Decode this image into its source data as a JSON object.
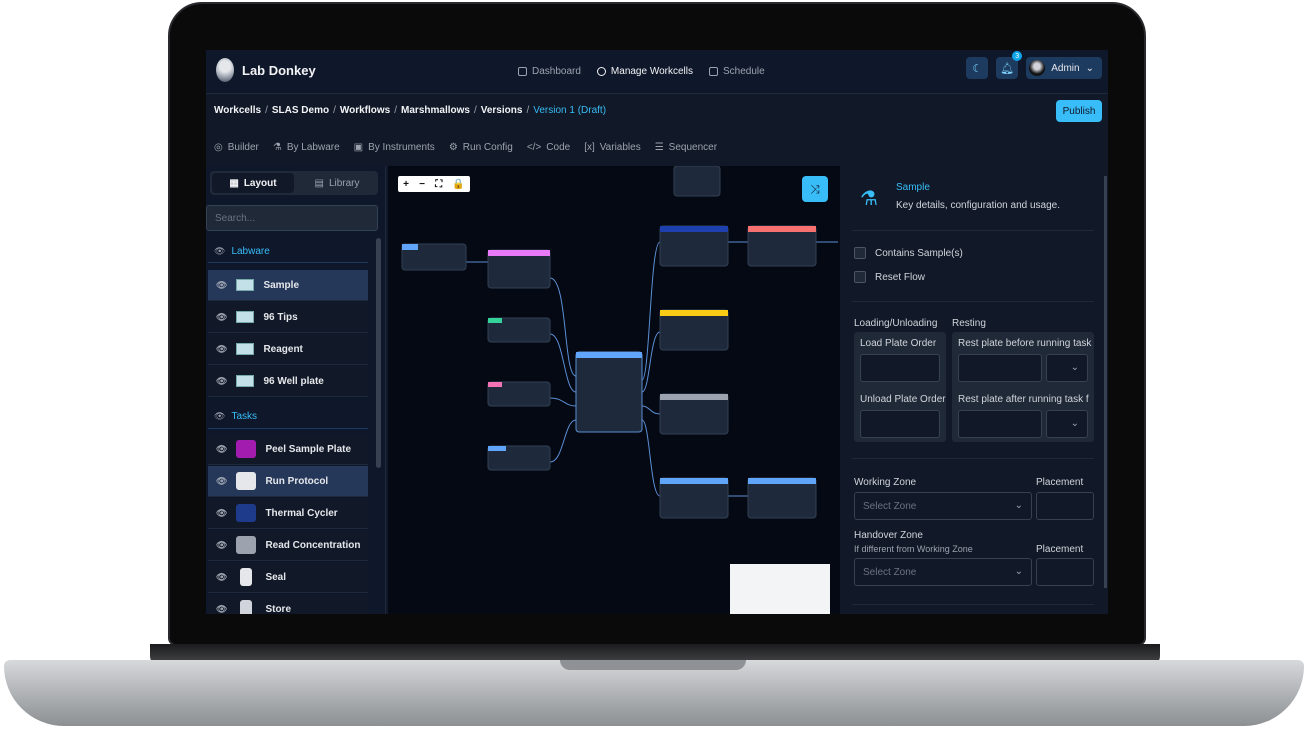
{
  "brand": {
    "name": "Lab Donkey"
  },
  "nav": {
    "items": [
      {
        "label": "Dashboard",
        "active": false
      },
      {
        "label": "Manage Workcells",
        "active": true
      },
      {
        "label": "Schedule",
        "active": false
      }
    ]
  },
  "header": {
    "notification_count": "3",
    "user": "Admin"
  },
  "breadcrumbs": {
    "items": [
      "Workcells",
      "SLAS Demo",
      "Workflows",
      "Marshmallows",
      "Versions"
    ],
    "current": "Version 1 (Draft)"
  },
  "actions": {
    "publish": "Publish"
  },
  "toolbar": {
    "items": [
      "Builder",
      "By Labware",
      "By Instruments",
      "Run Config",
      "Code",
      "Variables",
      "Sequencer"
    ]
  },
  "sidebar": {
    "tabs": [
      "Layout",
      "Library"
    ],
    "search_placeholder": "Search...",
    "labware_heading": "Labware",
    "labware": [
      "Sample",
      "96 Tips",
      "Reagent",
      "96 Well plate"
    ],
    "tasks_heading": "Tasks",
    "tasks": [
      {
        "label": "Peel Sample Plate",
        "color": "#a21caf"
      },
      {
        "label": "Run Protocol",
        "color": "#e5e7eb"
      },
      {
        "label": "Thermal Cycler",
        "color": "#1e3a8a"
      },
      {
        "label": "Read Concentration",
        "color": "#9ca3af"
      },
      {
        "label": "Seal",
        "color": "#e5e7eb"
      },
      {
        "label": "Store",
        "color": "#d1d5db"
      }
    ]
  },
  "canvas": {
    "zoom_controls": [
      "+",
      "−",
      "⛶",
      "🔒"
    ]
  },
  "props": {
    "title": "Sample",
    "subtitle": "Key details, configuration and usage.",
    "checks": [
      "Contains Sample(s)",
      "Reset Flow"
    ],
    "loading_heading": "Loading/Unloading",
    "resting_heading": "Resting",
    "load_plate_order": "Load Plate Order",
    "unload_plate_order": "Unload Plate Order",
    "rest_before": "Rest plate before running task",
    "rest_after": "Rest plate after running task f",
    "working_zone": "Working Zone",
    "placement": "Placement",
    "select_zone": "Select Zone",
    "handover_zone": "Handover Zone",
    "handover_hint": "If different from Working Zone"
  },
  "colors": {
    "accent": "#38bdf8",
    "bg": "#111827"
  }
}
